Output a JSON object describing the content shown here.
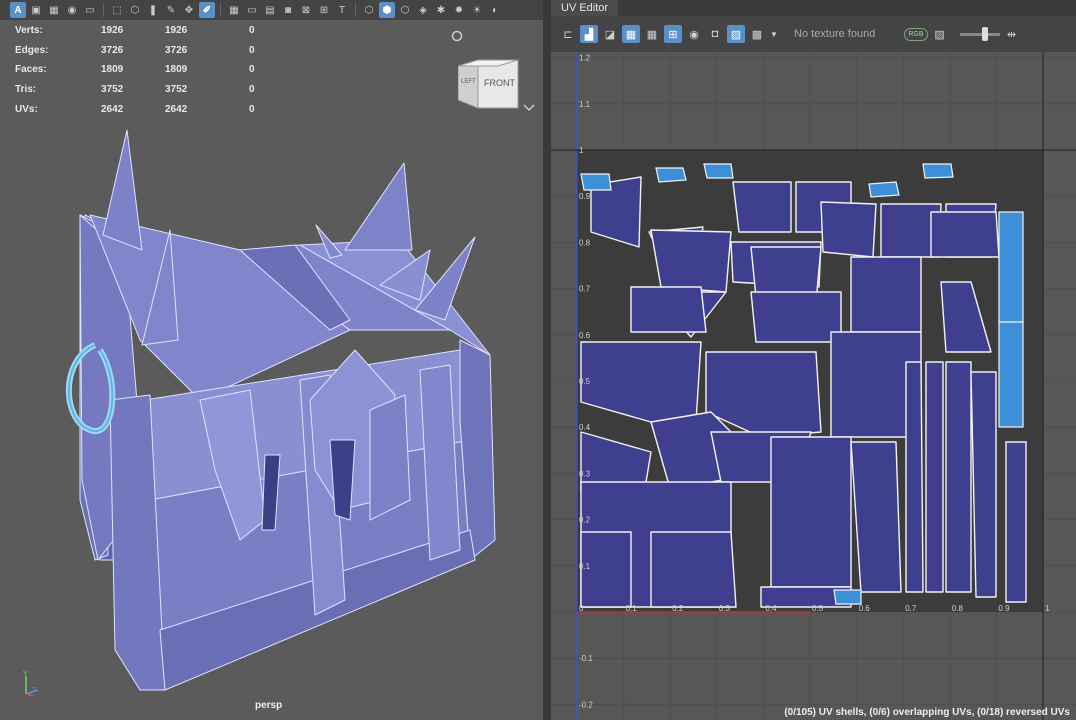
{
  "viewport": {
    "camera_label": "persp",
    "viewcube": {
      "left_face": "LEFT",
      "front_face": "FRONT"
    },
    "hud": [
      {
        "label": "Verts:",
        "v1": "1926",
        "v2": "1926",
        "v3": "0"
      },
      {
        "label": "Edges:",
        "v1": "3726",
        "v2": "3726",
        "v3": "0"
      },
      {
        "label": "Faces:",
        "v1": "1809",
        "v2": "1809",
        "v3": "0"
      },
      {
        "label": "Tris:",
        "v1": "3752",
        "v2": "3752",
        "v3": "0"
      },
      {
        "label": "UVs:",
        "v1": "2642",
        "v2": "2642",
        "v3": "0"
      }
    ],
    "toolbar_first_icon": "A",
    "axis": {
      "y": "Y",
      "z": "Z"
    }
  },
  "uv_editor": {
    "tab_title": "UV Editor",
    "no_texture": "No texture found",
    "rgb_label": "RGB",
    "status": "(0/105) UV shells, (0/6) overlapping UVs, (0/18) reversed UVs",
    "x_ticks": [
      "0",
      "0.1",
      "0.2",
      "0.3",
      "0.4",
      "0.5",
      "0.6",
      "0.7",
      "0.8",
      "0.9",
      "1"
    ],
    "y_ticks": [
      "1.2",
      "1.1",
      "1",
      "0.9",
      "0.8",
      "0.7",
      "0.6",
      "0.5",
      "0.4",
      "0.3",
      "0.2",
      "0.1",
      "-0.1",
      "-0.2"
    ]
  },
  "colors": {
    "mesh": "#7b80c6",
    "uv_shell": "#3f3f8f",
    "uv_selected": "#3d8fd8",
    "accent": "#5a8fc8"
  }
}
